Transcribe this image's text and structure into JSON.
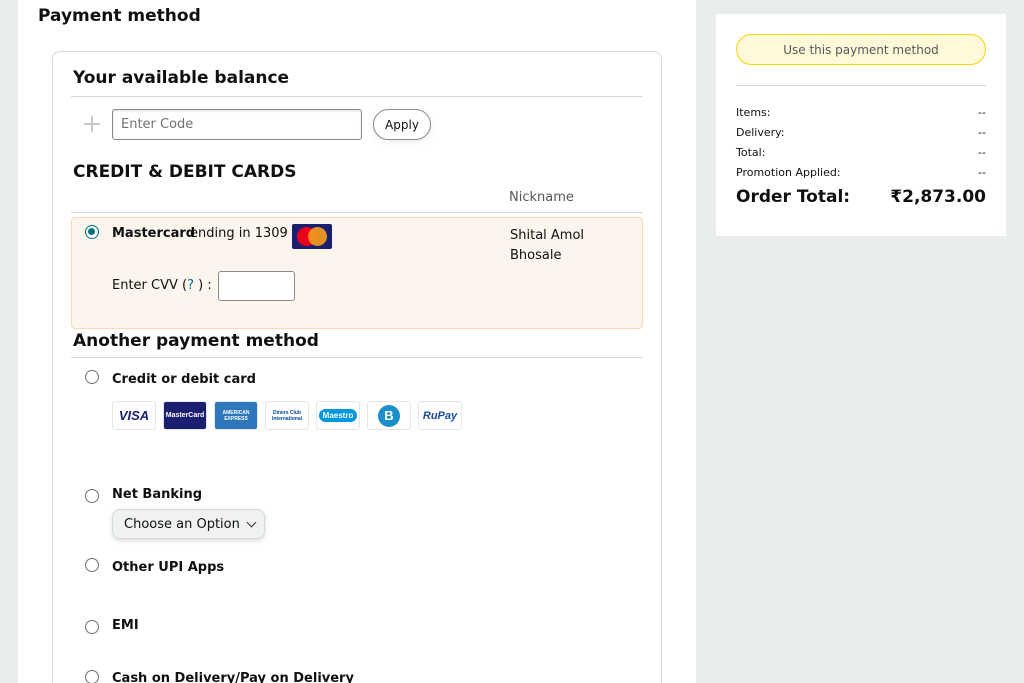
{
  "page_title": "Payment method",
  "balance": {
    "heading": "Your available balance",
    "code_placeholder": "Enter Code",
    "apply_label": "Apply"
  },
  "cards": {
    "heading": "CREDIT & DEBIT CARDS",
    "nickname_header": "Nickname",
    "saved": {
      "brand": "Mastercard",
      "ending": "ending in 1309",
      "nickname": "Shital Amol Bhosale",
      "cvv_label": "Enter CVV",
      "cvv_help": "?",
      "selected": true
    }
  },
  "another": {
    "heading": "Another payment method",
    "options": [
      {
        "label": "Credit or debit card"
      },
      {
        "label": "Net Banking"
      },
      {
        "label": "Other UPI Apps"
      },
      {
        "label": "EMI"
      },
      {
        "label": "Cash on Delivery/Pay on Delivery"
      }
    ],
    "card_logos": [
      "VISA",
      "MasterCard",
      "AMERICAN EXPRESS",
      "Diners Club International",
      "Maestro",
      "B",
      "RuPay"
    ],
    "netbanking_select": "Choose an Option"
  },
  "summary": {
    "use_button": "Use this payment method",
    "rows": [
      {
        "label": "Items:",
        "value": "--"
      },
      {
        "label": "Delivery:",
        "value": "--"
      },
      {
        "label": "Total:",
        "value": "--"
      },
      {
        "label": "Promotion Applied:",
        "value": "--"
      }
    ],
    "order_total_label": "Order Total:",
    "order_total_value": "₹2,873.00"
  },
  "colors": {
    "selected_bg": "#fcf5ee",
    "accent_link": "#007185",
    "button_yellow": "#fff9d9"
  }
}
